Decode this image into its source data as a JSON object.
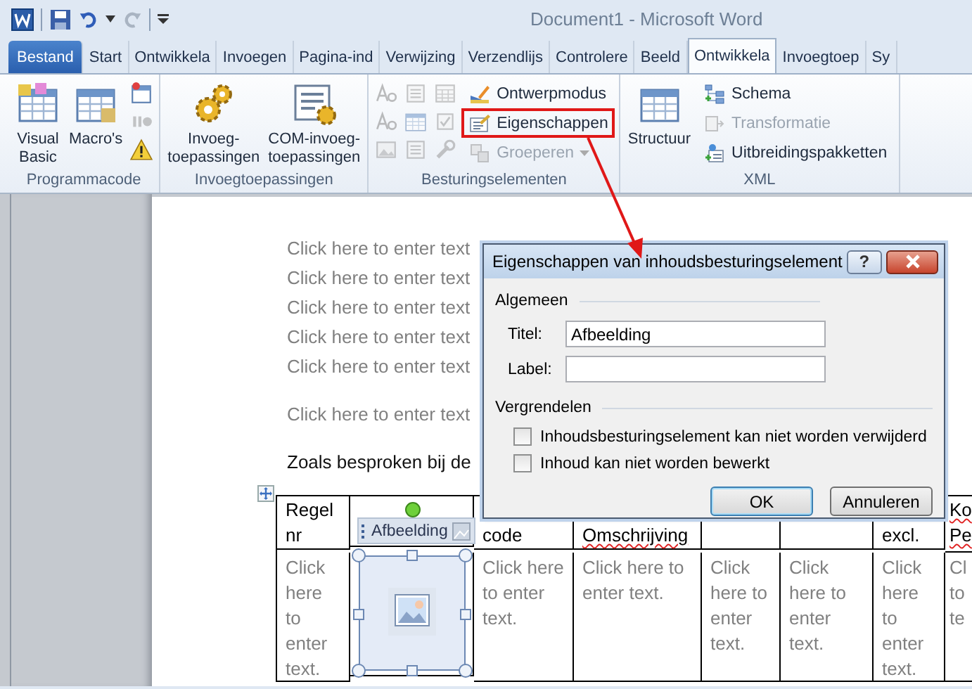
{
  "title_bar": {
    "title": "Document1  -  Microsoft Word"
  },
  "tabs": [
    {
      "label": "Bestand",
      "kind": "file",
      "selected": false
    },
    {
      "label": "Start",
      "kind": "tab",
      "selected": false
    },
    {
      "label": "Ontwikkela",
      "kind": "tab",
      "selected": false
    },
    {
      "label": "Invoegen",
      "kind": "tab",
      "selected": false
    },
    {
      "label": "Pagina-ind",
      "kind": "tab",
      "selected": false
    },
    {
      "label": "Verwijzing",
      "kind": "tab",
      "selected": false
    },
    {
      "label": "Verzendlijs",
      "kind": "tab",
      "selected": false
    },
    {
      "label": "Controlere",
      "kind": "tab",
      "selected": false
    },
    {
      "label": "Beeld",
      "kind": "tab",
      "selected": false
    },
    {
      "label": "Ontwikkela",
      "kind": "tab",
      "selected": true
    },
    {
      "label": "Invoegtoep",
      "kind": "tab",
      "selected": false
    },
    {
      "label": "Sy",
      "kind": "tab",
      "selected": false
    }
  ],
  "ribbon": [
    {
      "label": "Programmacode",
      "items": [
        {
          "kind": "large",
          "lines": [
            "Visual",
            "Basic"
          ],
          "disabled": false
        },
        {
          "kind": "large",
          "lines": [
            "Macro's"
          ],
          "disabled": false
        },
        {
          "kind": "icon",
          "disabled": false
        },
        {
          "kind": "icon",
          "disabled": true
        },
        {
          "kind": "icon",
          "disabled": false
        }
      ]
    },
    {
      "label": "Invoegtoepassingen",
      "items": [
        {
          "kind": "large",
          "lines": [
            "Invoeg-",
            "toepassingen"
          ],
          "disabled": false
        },
        {
          "kind": "large",
          "lines": [
            "COM-invoeg-",
            "toepassingen"
          ],
          "disabled": false
        }
      ]
    },
    {
      "label": "Besturingselementen",
      "items": [
        {
          "kind": "icon",
          "disabled": true
        },
        {
          "kind": "icon",
          "disabled": true
        },
        {
          "kind": "icon",
          "disabled": true
        },
        {
          "kind": "icon",
          "disabled": true
        },
        {
          "kind": "icon",
          "disabled": true
        },
        {
          "kind": "icon",
          "disabled": true
        },
        {
          "kind": "icon",
          "disabled": true
        },
        {
          "kind": "icon",
          "disabled": true
        },
        {
          "kind": "icon",
          "disabled": true
        },
        {
          "kind": "small",
          "label": "Ontwerpmodus",
          "disabled": false,
          "highlighted": false,
          "dropdown": false
        },
        {
          "kind": "small",
          "label": "Eigenschappen",
          "disabled": false,
          "highlighted": true,
          "dropdown": false
        },
        {
          "kind": "small",
          "label": "Groeperen",
          "disabled": true,
          "highlighted": false,
          "dropdown": true
        }
      ]
    },
    {
      "label": "XML",
      "items": [
        {
          "kind": "large",
          "lines": [
            "Structuur"
          ],
          "disabled": false
        },
        {
          "kind": "small",
          "label": "Schema",
          "disabled": false,
          "highlighted": false,
          "dropdown": false
        },
        {
          "kind": "small",
          "label": "Transformatie",
          "disabled": true,
          "highlighted": false,
          "dropdown": false
        },
        {
          "kind": "small",
          "label": "Uitbreidingspakketten",
          "disabled": false,
          "highlighted": false,
          "dropdown": false
        }
      ]
    }
  ],
  "document": {
    "paragraphs": [
      {
        "kind": "placeholder",
        "text": "Click here to enter text"
      },
      {
        "kind": "placeholder",
        "text": "Click here to enter text"
      },
      {
        "kind": "placeholder",
        "text": "Click here to enter text"
      },
      {
        "kind": "placeholder",
        "text": "Click here to enter text"
      },
      {
        "kind": "placeholder",
        "text": "Click here to enter text"
      },
      {
        "kind": "gap"
      },
      {
        "kind": "placeholder",
        "text": "Click here to enter text"
      },
      {
        "kind": "gap"
      },
      {
        "kind": "body",
        "text": "Zoals besproken bij de"
      }
    ],
    "table": {
      "columns": [
        {
          "heading": "Regel nr",
          "misspelled": false
        },
        {
          "tag": "Afbeelding"
        },
        {
          "heading": "code",
          "misspelled": false
        },
        {
          "heading": "Omschrijving",
          "misspelled": true
        },
        {},
        {},
        {
          "heading": "excl.",
          "misspelled": false
        },
        {
          "heading": "Ko Pe",
          "misspelled": true
        }
      ],
      "rows": [
        [
          {
            "kind": "placeholder",
            "text": "Click here to enter text."
          },
          {
            "kind": "picture"
          },
          {
            "kind": "placeholder",
            "text": "Click here to enter text."
          },
          {
            "kind": "placeholder",
            "text": "Click here to enter text."
          },
          {
            "kind": "placeholder",
            "text": "Click here to enter text."
          },
          {
            "kind": "placeholder",
            "text": "Click here to enter text."
          },
          {
            "kind": "placeholder",
            "text": "Click here to enter text."
          },
          {
            "kind": "placeholder",
            "text": "Cl to te"
          }
        ]
      ]
    }
  },
  "dialog": {
    "title": "Eigenschappen van inhoudsbesturingselement",
    "help_button": "?",
    "general": {
      "heading": "Algemeen",
      "fields": [
        {
          "label": "Titel:",
          "value": "Afbeelding"
        },
        {
          "label": "Label:"
        }
      ]
    },
    "lock": {
      "heading": "Vergrendelen",
      "options": [
        {
          "label": "Inhoudsbesturingselement kan niet worden verwijderd",
          "checked": false
        },
        {
          "label": "Inhoud kan niet worden bewerkt",
          "checked": false
        }
      ]
    },
    "buttons": [
      {
        "label": "OK",
        "default": true
      },
      {
        "label": "Annuleren",
        "default": false
      }
    ]
  }
}
